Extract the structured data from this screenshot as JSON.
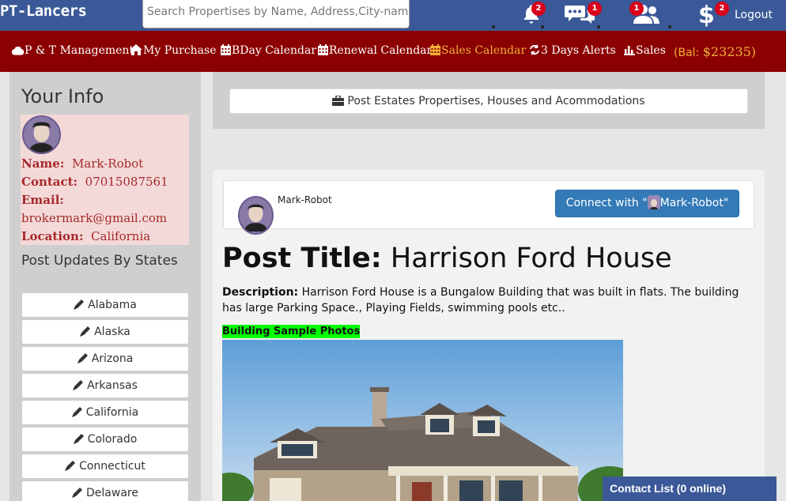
{
  "header": {
    "brand": "PT-Lancers",
    "search_placeholder": "Search Propertises by Name, Address,City-name",
    "notifications_count": "2",
    "messages_count": "1",
    "friend_requests_count": "1",
    "balance_alerts_count": "2",
    "logout_label": "Logout"
  },
  "nav": {
    "items": [
      {
        "label": "P & T Management",
        "icon": "cloud-icon"
      },
      {
        "label": "My Purchase",
        "icon": "home-icon"
      },
      {
        "label": "BDay Calendar",
        "icon": "calendar-icon"
      },
      {
        "label": "Renewal Calendar",
        "icon": "calendar-icon"
      },
      {
        "label": "Sales Calendar",
        "icon": "calendar-icon"
      },
      {
        "label": "3 Days Alerts",
        "icon": "refresh-icon"
      },
      {
        "label": "Sales",
        "icon": "bar-chart-icon"
      }
    ],
    "balance_label": "(Bal:",
    "balance_value": "$23235)"
  },
  "sidebar": {
    "title": "Your Info",
    "name_key": "Name:",
    "name_value": "Mark-Robot",
    "contact_key": "Contact:",
    "contact_value": "07015087561",
    "email_key": "Email:",
    "email_value": "brokermark@gmail.com",
    "location_key": "Location:",
    "location_value": "California",
    "updates_title": "Post Updates By States",
    "states": [
      "Alabama",
      "Alaska",
      "Arizona",
      "Arkansas",
      "California",
      "Colorado",
      "Connecticut",
      "Delaware"
    ]
  },
  "main": {
    "post_button_label": "Post Estates Propertises, Houses and Acommodations",
    "author_name": "Mark-Robot",
    "connect_prefix": "Connect with \"",
    "connect_name": "Mark-Robot\"",
    "title_key": "Post Title:",
    "title_value": "Harrison Ford House",
    "description_key": "Description:",
    "description_value": "Harrison Ford House is a Bungalow Building that was built in flats. The building has large Parking Space., Playing Fields, swimming pools etc..",
    "photos_label": "Building Sample Photos"
  },
  "contact_list": {
    "label": "Contact List (0 online)"
  },
  "colors": {
    "topbar": "#3b5998",
    "navbar": "#8b0000",
    "accent_orange": "#f0b13a",
    "badge": "#d9001b",
    "primary_button": "#337ab7",
    "highlight": "#00ff00"
  }
}
